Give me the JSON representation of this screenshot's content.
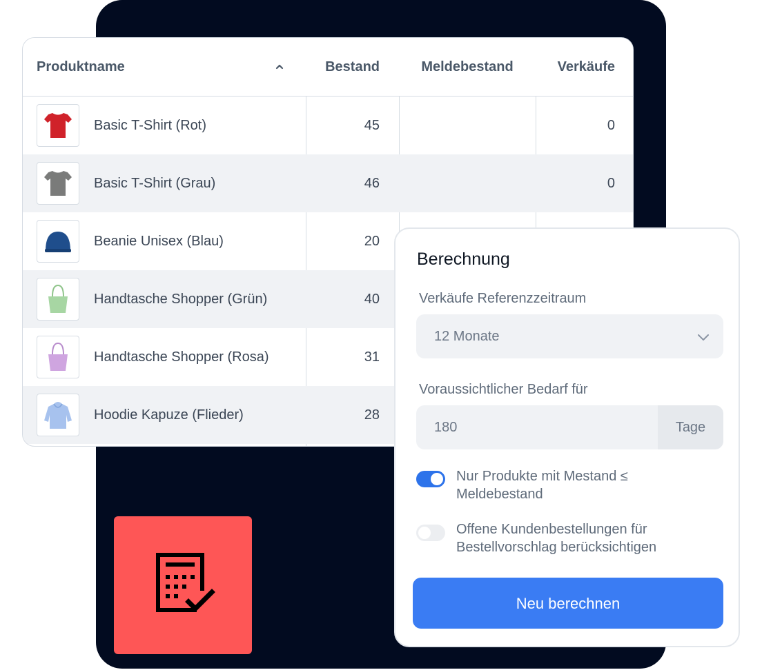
{
  "table": {
    "columns": {
      "name": "Produktname",
      "bestand": "Bestand",
      "meldebestand": "Meldebestand",
      "verkaeufe": "Verkäufe"
    },
    "rows": [
      {
        "name": "Basic T-Shirt (Rot)",
        "bestand": "45",
        "meldebestand": "",
        "verkaeufe": "0",
        "thumb_icon": "tshirt-icon",
        "color": "#d0222a"
      },
      {
        "name": "Basic T-Shirt (Grau)",
        "bestand": "46",
        "meldebestand": "",
        "verkaeufe": "0",
        "thumb_icon": "tshirt-icon",
        "color": "#7a7b7a"
      },
      {
        "name": "Beanie Unisex (Blau)",
        "bestand": "20",
        "meldebestand": "",
        "verkaeufe": "",
        "thumb_icon": "beanie-icon",
        "color": "#1f4e8c"
      },
      {
        "name": "Handtasche Shopper (Grün)",
        "bestand": "40",
        "meldebestand": "",
        "verkaeufe": "",
        "thumb_icon": "tote-bag-icon",
        "color": "#a7d6a3"
      },
      {
        "name": "Handtasche Shopper (Rosa)",
        "bestand": "31",
        "meldebestand": "",
        "verkaeufe": "",
        "thumb_icon": "tote-bag-icon",
        "color": "#cfa5e0"
      },
      {
        "name": "Hoodie Kapuze (Flieder)",
        "bestand": "28",
        "meldebestand": "",
        "verkaeufe": "",
        "thumb_icon": "hoodie-icon",
        "color": "#a7c2ee"
      }
    ]
  },
  "panel": {
    "title": "Berechnung",
    "reference_label": "Verkäufe Referenzzeitraum",
    "reference_value": "12 Monate",
    "demand_label": "Voraussichtlicher Bedarf für",
    "demand_value": "180",
    "demand_unit": "Tage",
    "toggle1_label": "Nur Produkte mit Mestand ≤ Meldebestand",
    "toggle1_on": true,
    "toggle2_label": "Offene Kundenbestellungen für Bestellvorschlag berücksichtigen",
    "toggle2_on": false,
    "button_label": "Neu berechnen"
  },
  "colors": {
    "accent": "#3a7cf3",
    "tile": "#fe5656",
    "backdrop": "#020b20"
  },
  "icons": {
    "calculator": "calculator-check-icon",
    "sort": "chevron-up-icon",
    "select": "chevron-down-icon"
  }
}
